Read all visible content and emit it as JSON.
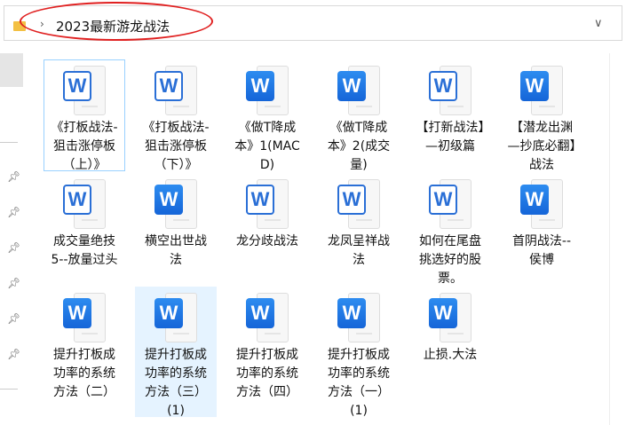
{
  "address_bar": {
    "path": "2023最新游龙战法"
  },
  "files": [
    {
      "name": "《打板战法-狙击涨停板（上）》",
      "icon": "outline"
    },
    {
      "name": "《打板战法-狙击涨停板（下）》",
      "icon": "outline"
    },
    {
      "name": "《做T降成本》1(MACD)",
      "icon": "filled"
    },
    {
      "name": "《做T降成本》2(成交量)",
      "icon": "filled"
    },
    {
      "name": "【打新战法】—初级篇",
      "icon": "outline"
    },
    {
      "name": "【潜龙出渊—抄底必翻】战法",
      "icon": "filled"
    },
    {
      "name": "成交量绝技5--放量过头",
      "icon": "outline"
    },
    {
      "name": "横空出世战法",
      "icon": "filled"
    },
    {
      "name": "龙分歧战法",
      "icon": "outline"
    },
    {
      "name": "龙凤呈祥战法",
      "icon": "outline"
    },
    {
      "name": "如何在尾盘挑选好的股票。",
      "icon": "outline"
    },
    {
      "name": "首阴战法--侯博",
      "icon": "filled"
    },
    {
      "name": "提升打板成功率的系统方法（二）",
      "icon": "filled"
    },
    {
      "name": "提升打板成功率的系统方法（三）(1)",
      "icon": "filled"
    },
    {
      "name": "提升打板成功率的系统方法（四）",
      "icon": "filled"
    },
    {
      "name": "提升打板成功率的系统方法（一）(1)",
      "icon": "filled"
    },
    {
      "name": "止损.大法",
      "icon": "filled"
    }
  ],
  "icon_letter": "W"
}
